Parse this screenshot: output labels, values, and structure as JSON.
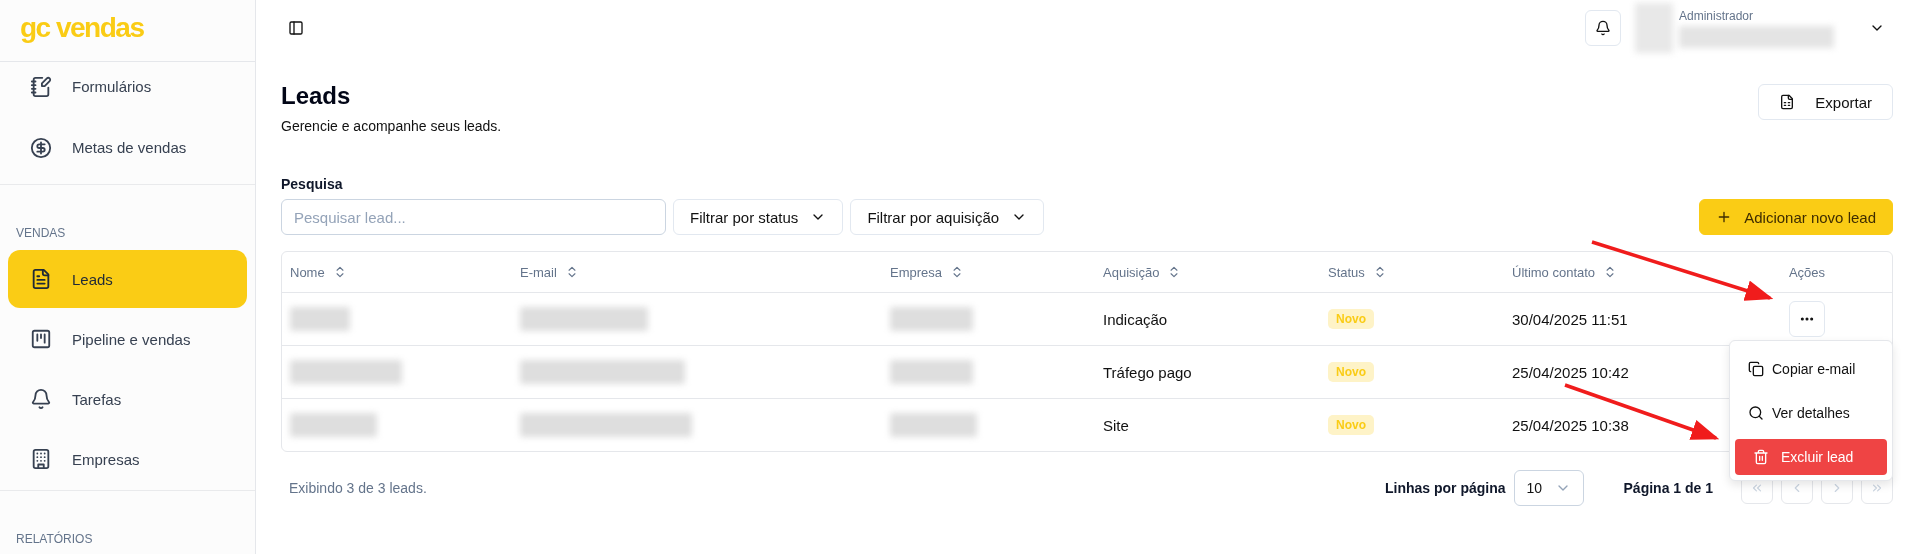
{
  "sidebar": {
    "logo": "gc vendas",
    "sections": [
      {
        "items": [
          {
            "label": "Formulários",
            "selected": false
          },
          {
            "label": "Metas de vendas",
            "selected": false
          }
        ]
      },
      {
        "label": "VENDAS",
        "items": [
          {
            "label": "Leads",
            "selected": true
          },
          {
            "label": "Pipeline e vendas",
            "selected": false
          },
          {
            "label": "Tarefas",
            "selected": false
          },
          {
            "label": "Empresas",
            "selected": false
          }
        ]
      },
      {
        "label": "RELATÓRIOS"
      }
    ]
  },
  "header": {
    "user_role": "Administrador"
  },
  "page": {
    "title": "Leads",
    "subtitle": "Gerencie e acompanhe seus leads.",
    "export_button": "Exportar"
  },
  "search": {
    "label": "Pesquisa",
    "placeholder": "Pesquisar lead..."
  },
  "filters": [
    "Filtrar por status",
    "Filtrar por aquisição"
  ],
  "add_button": "Adicionar novo lead",
  "table": {
    "columns": [
      "Nome",
      "E-mail",
      "Empresa",
      "Aquisição",
      "Status",
      "Último contato",
      "Ações"
    ],
    "rows": [
      {
        "acquisition": "Indicação",
        "status": "Novo",
        "last_contact": "30/04/2025 11:51"
      },
      {
        "acquisition": "Tráfego pago",
        "status": "Novo",
        "last_contact": "25/04/2025 10:42"
      },
      {
        "acquisition": "Site",
        "status": "Novo",
        "last_contact": "25/04/2025 10:38"
      }
    ]
  },
  "row_menu": [
    {
      "kind": "copy",
      "label": "Copiar e-mail"
    },
    {
      "kind": "view",
      "label": "Ver detalhes"
    },
    {
      "kind": "delete",
      "label": "Excluir lead"
    }
  ],
  "footer": {
    "summary": "Exibindo 3 de 3 leads.",
    "rows_per_page_label": "Linhas por página",
    "rows_per_page": "10",
    "page_info": "Página 1 de 1",
    "pager": [
      {
        "kind": "first",
        "disabled": true
      },
      {
        "kind": "prev",
        "disabled": true
      },
      {
        "kind": "next",
        "disabled": true
      },
      {
        "kind": "last",
        "disabled": true
      }
    ]
  }
}
